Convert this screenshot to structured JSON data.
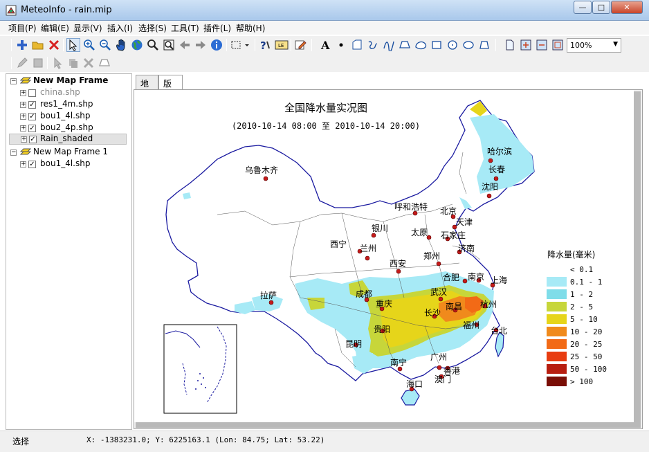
{
  "window": {
    "title": "MeteoInfo - rain.mip",
    "minimize": "—",
    "maximize": "□",
    "close": "✕"
  },
  "menu": [
    "项目(P)",
    "编辑(E)",
    "显示(V)",
    "插入(I)",
    "选择(S)",
    "工具(T)",
    "插件(L)",
    "帮助(H)"
  ],
  "toolbar": {
    "zoom_value": "100%"
  },
  "layers": {
    "frame1": "New Map Frame",
    "items": [
      "china.shp",
      "res1_4m.shp",
      "bou1_4l.shp",
      "bou2_4p.shp",
      "Rain_shaded"
    ],
    "checked": [
      false,
      true,
      true,
      true,
      true
    ],
    "frame2": "New Map Frame 1",
    "frame2_items": [
      "bou1_4l.shp"
    ]
  },
  "tabs": [
    "地图",
    "版面"
  ],
  "map": {
    "title": "全国降水量实况图",
    "subtitle": "(2010-10-14 08:00 至 2010-10-14 20:00)",
    "cities": [
      "乌鲁木齐",
      "哈尔滨",
      "长春",
      "沈阳",
      "呼和浩特",
      "北京",
      "天津",
      "银川",
      "太原",
      "石家庄",
      "西宁",
      "兰州",
      "济南",
      "郑州",
      "西安",
      "合肥",
      "南京",
      "上海",
      "拉萨",
      "成都",
      "武汉",
      "重庆",
      "南昌",
      "杭州",
      "长沙",
      "贵阳",
      "福州",
      "台北",
      "昆明",
      "广州",
      "南宁",
      "香港",
      "澳门",
      "海口"
    ],
    "legend": {
      "title": "降水量(毫米)",
      "labels": [
        "< 0.1",
        "0.1 - 1",
        "1 - 2",
        "2 - 5",
        "5 - 10",
        "10 - 20",
        "20 - 25",
        "25 - 50",
        "50 - 100",
        "> 100"
      ],
      "colors": [
        "#ffffff",
        "#a7eaf6",
        "#7fdde9",
        "#c7d63a",
        "#e6d51a",
        "#f08a1c",
        "#f26a16",
        "#e83c10",
        "#b81e10",
        "#7a0e06"
      ]
    }
  },
  "status": {
    "mode": "选择",
    "coords": "X: -1383231.0; Y: 6225163.1 (Lon: 84.75; Lat: 53.22)"
  }
}
